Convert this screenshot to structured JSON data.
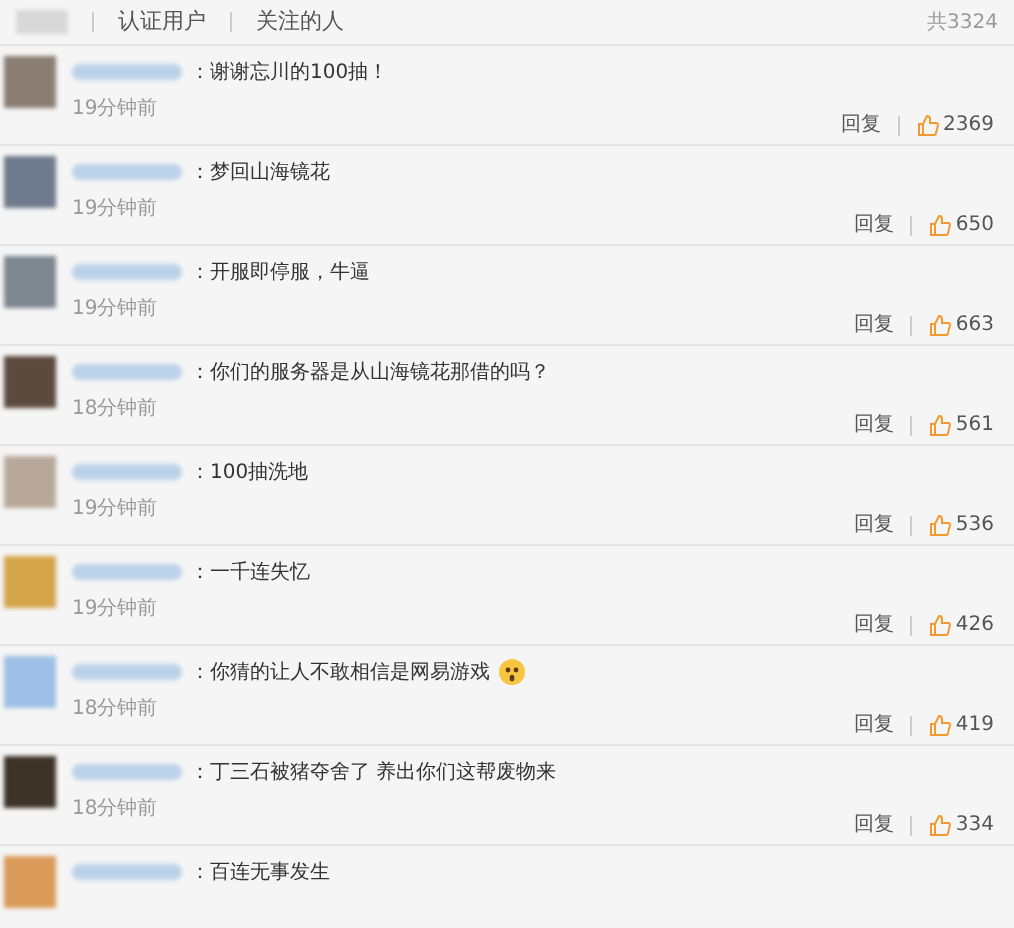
{
  "filters": [
    {
      "label": "认证用户"
    },
    {
      "label": "关注的人"
    }
  ],
  "total": "共3324",
  "comments": [
    {
      "text": "：谢谢忘川的100抽！",
      "time": "19分钟前",
      "reply": "回复",
      "likes": "2369"
    },
    {
      "text": "：梦回山海镜花",
      "time": "19分钟前",
      "reply": "回复",
      "likes": "650"
    },
    {
      "text": "：开服即停服，牛逼",
      "time": "19分钟前",
      "reply": "回复",
      "likes": "663"
    },
    {
      "text": "：你们的服务器是从山海镜花那借的吗？",
      "time": "18分钟前",
      "reply": "回复",
      "likes": "561"
    },
    {
      "text": "：100抽洗地",
      "time": "19分钟前",
      "reply": "回复",
      "likes": "536"
    },
    {
      "text": "：一千连失忆",
      "time": "19分钟前",
      "reply": "回复",
      "likes": "426"
    },
    {
      "text": "：你猜的让人不敢相信是网易游戏",
      "time": "18分钟前",
      "reply": "回复",
      "likes": "419",
      "emoji": true
    },
    {
      "text": "：丁三石被猪夺舍了 养出你们这帮废物来",
      "time": "18分钟前",
      "reply": "回复",
      "likes": "334"
    },
    {
      "text": "：百连无事发生"
    }
  ]
}
